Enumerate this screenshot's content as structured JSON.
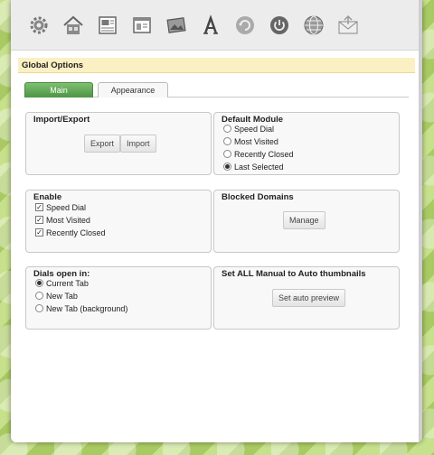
{
  "toolbar": {
    "icons": [
      "gear-icon",
      "home-icon",
      "dashboard-icon",
      "thumbnails-icon",
      "image-icon",
      "font-icon",
      "refresh-icon",
      "power-icon",
      "globe-icon",
      "mail-icon"
    ]
  },
  "section": {
    "title": "Global Options"
  },
  "tabs": [
    {
      "label": "Main",
      "active": true
    },
    {
      "label": "Appearance",
      "active": false
    }
  ],
  "import_export": {
    "title": "Import/Export",
    "export_label": "Export",
    "import_label": "Import"
  },
  "default_module": {
    "title": "Default Module",
    "options": [
      "Speed Dial",
      "Most Visited",
      "Recently Closed",
      "Last Selected"
    ],
    "selected": "Last Selected"
  },
  "enable": {
    "title": "Enable",
    "options": [
      "Speed Dial",
      "Most Visited",
      "Recently Closed"
    ],
    "checked": [
      true,
      true,
      true
    ]
  },
  "blocked_domains": {
    "title": "Blocked Domains",
    "manage_label": "Manage"
  },
  "dials_open_in": {
    "title": "Dials open in:",
    "options": [
      "Current Tab",
      "New Tab",
      "New Tab (background)"
    ],
    "selected": "Current Tab"
  },
  "auto_thumbnails": {
    "title": "Set ALL Manual to Auto thumbnails",
    "button_label": "Set auto preview"
  },
  "colors": {
    "accent_green": "#4c9444",
    "section_bg": "#fbf0c4"
  }
}
